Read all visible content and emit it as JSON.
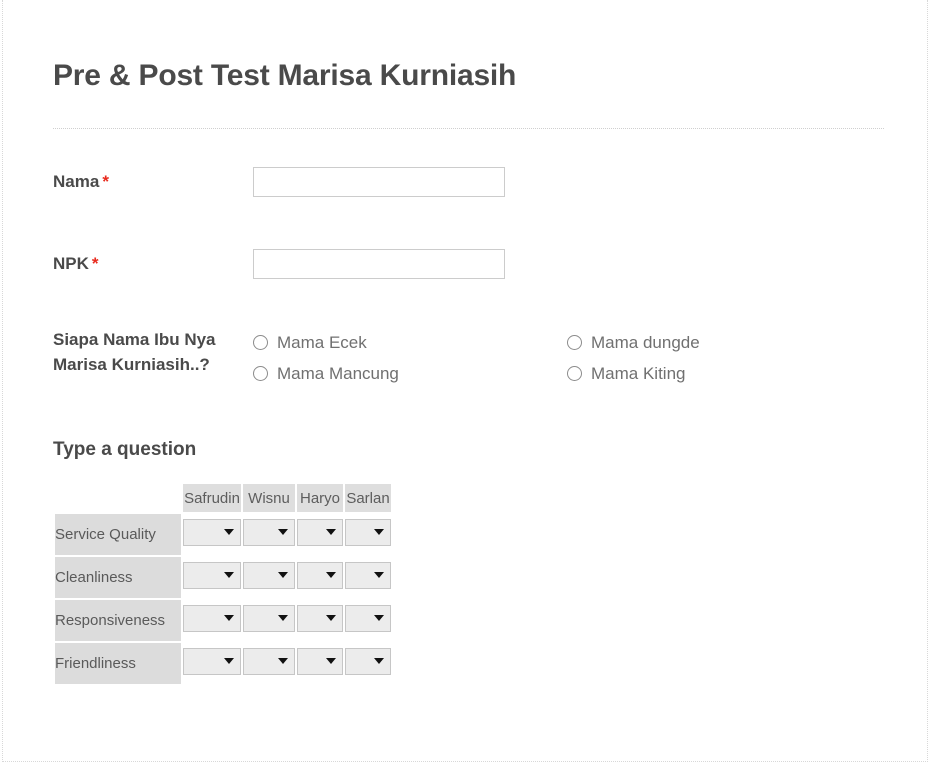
{
  "form": {
    "title": "Pre & Post Test Marisa Kurniasih",
    "required_marker": "*"
  },
  "fields": {
    "nama": {
      "label": "Nama",
      "required": true,
      "value": "",
      "placeholder": ""
    },
    "npk": {
      "label": "NPK",
      "required": true,
      "value": "",
      "placeholder": ""
    }
  },
  "radio_question": {
    "label": "Siapa Nama Ibu Nya Marisa Kurniasih..?",
    "columns": [
      {
        "options": [
          "Mama Ecek",
          "Mama Mancung"
        ]
      },
      {
        "options": [
          "Mama dungde",
          "Mama Kiting"
        ]
      }
    ]
  },
  "matrix_question": {
    "heading": "Type a question",
    "corner_label": "",
    "columns": [
      "Safrudin",
      "Wisnu",
      "Haryo",
      "Sarlan"
    ],
    "rows": [
      {
        "label": "Service Quality",
        "values": [
          "",
          "",
          "",
          ""
        ]
      },
      {
        "label": "Cleanliness",
        "values": [
          "",
          "",
          "",
          ""
        ]
      },
      {
        "label": "Responsiveness",
        "values": [
          "",
          "",
          "",
          ""
        ]
      },
      {
        "label": "Friendliness",
        "values": [
          "",
          "",
          "",
          ""
        ]
      }
    ],
    "dropdown_icon": "chevron-down-icon"
  },
  "colors": {
    "title_text": "#4a4a4a",
    "label_text": "#4a4a4a",
    "body_text": "#707070",
    "required_star": "#e8291c",
    "header_cell_bg": "#dedede",
    "row_head_bg": "#dcdcdc",
    "select_bg": "#ececec",
    "input_border": "#cccccc"
  }
}
